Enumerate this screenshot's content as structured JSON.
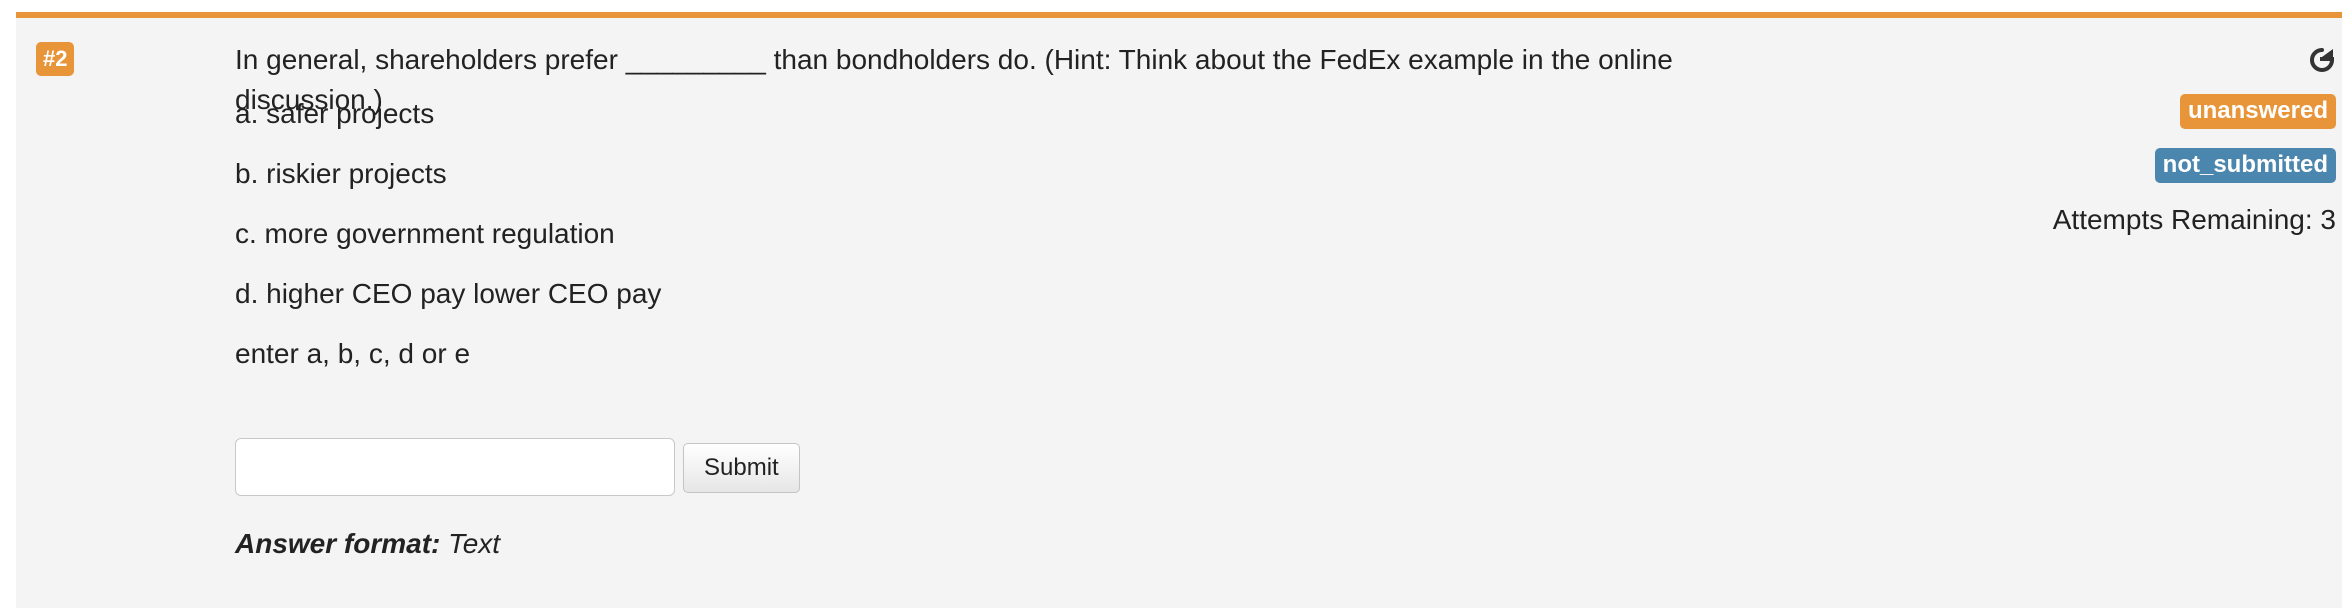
{
  "question": {
    "number": "#2",
    "prompt_before": "In general, shareholders prefer ",
    "prompt_blank": "_________",
    "prompt_after": " than bondholders do. (Hint: Think about the FedEx example in the online discussion.)",
    "choices": [
      "a. safer projects",
      "b. riskier projects",
      "c. more government regulation",
      "d. higher CEO pay lower CEO pay"
    ],
    "instruction": "enter a, b, c, d or e",
    "answer": {
      "value": "",
      "placeholder": ""
    },
    "submit_label": "Submit",
    "format_label": "Answer format:",
    "format_value": "Text"
  },
  "status": {
    "answer_state": "unanswered",
    "submission_state": "not_submitted",
    "attempts_remaining": "Attempts Remaining: 3"
  },
  "icons": {
    "reload": "reload-icon"
  },
  "colors": {
    "accent_orange": "#e8953a",
    "status_blue": "#4a86ae",
    "panel_bg": "#f4f4f4"
  }
}
